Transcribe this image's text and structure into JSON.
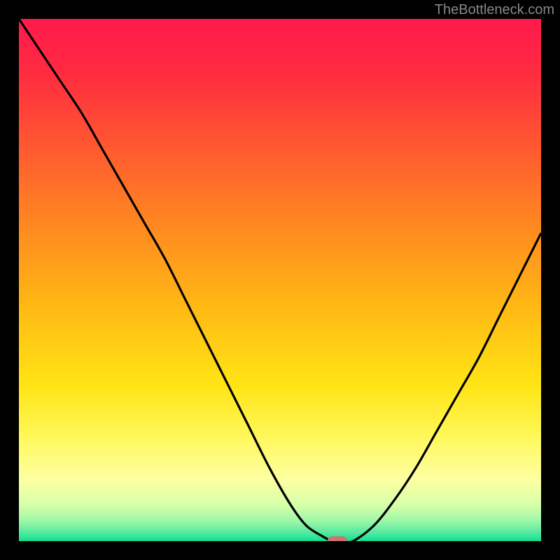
{
  "watermark": "TheBottleneck.com",
  "chart_data": {
    "type": "line",
    "title": "",
    "xlabel": "",
    "ylabel": "",
    "xlim": [
      0,
      100
    ],
    "ylim": [
      0,
      100
    ],
    "background_type": "vertical_gradient",
    "background_colors": [
      {
        "pos": 0.0,
        "color": "#ff1a4d"
      },
      {
        "pos": 0.1,
        "color": "#ff2a40"
      },
      {
        "pos": 0.25,
        "color": "#ff5a30"
      },
      {
        "pos": 0.4,
        "color": "#ff8a20"
      },
      {
        "pos": 0.55,
        "color": "#ffb814"
      },
      {
        "pos": 0.7,
        "color": "#ffe414"
      },
      {
        "pos": 0.8,
        "color": "#fff85a"
      },
      {
        "pos": 0.88,
        "color": "#feffa0"
      },
      {
        "pos": 0.93,
        "color": "#d8ffaa"
      },
      {
        "pos": 0.96,
        "color": "#a0f8a8"
      },
      {
        "pos": 0.985,
        "color": "#50e8a0"
      },
      {
        "pos": 1.0,
        "color": "#10e090"
      }
    ],
    "series": [
      {
        "name": "bottleneck-curve",
        "color": "#000000",
        "x": [
          0,
          4,
          8,
          12,
          16,
          20,
          24,
          28,
          32,
          36,
          40,
          44,
          48,
          52,
          55,
          58,
          60,
          62,
          64,
          68,
          72,
          76,
          80,
          84,
          88,
          92,
          96,
          100
        ],
        "y": [
          100,
          94,
          88,
          82,
          75,
          68,
          61,
          54,
          46,
          38,
          30,
          22,
          14,
          7,
          3,
          1,
          0,
          0,
          0,
          3,
          8,
          14,
          21,
          28,
          35,
          43,
          51,
          59
        ]
      }
    ],
    "marker": {
      "x": 61,
      "y": 0,
      "label": "optimal-point",
      "color": "#c97870"
    }
  }
}
